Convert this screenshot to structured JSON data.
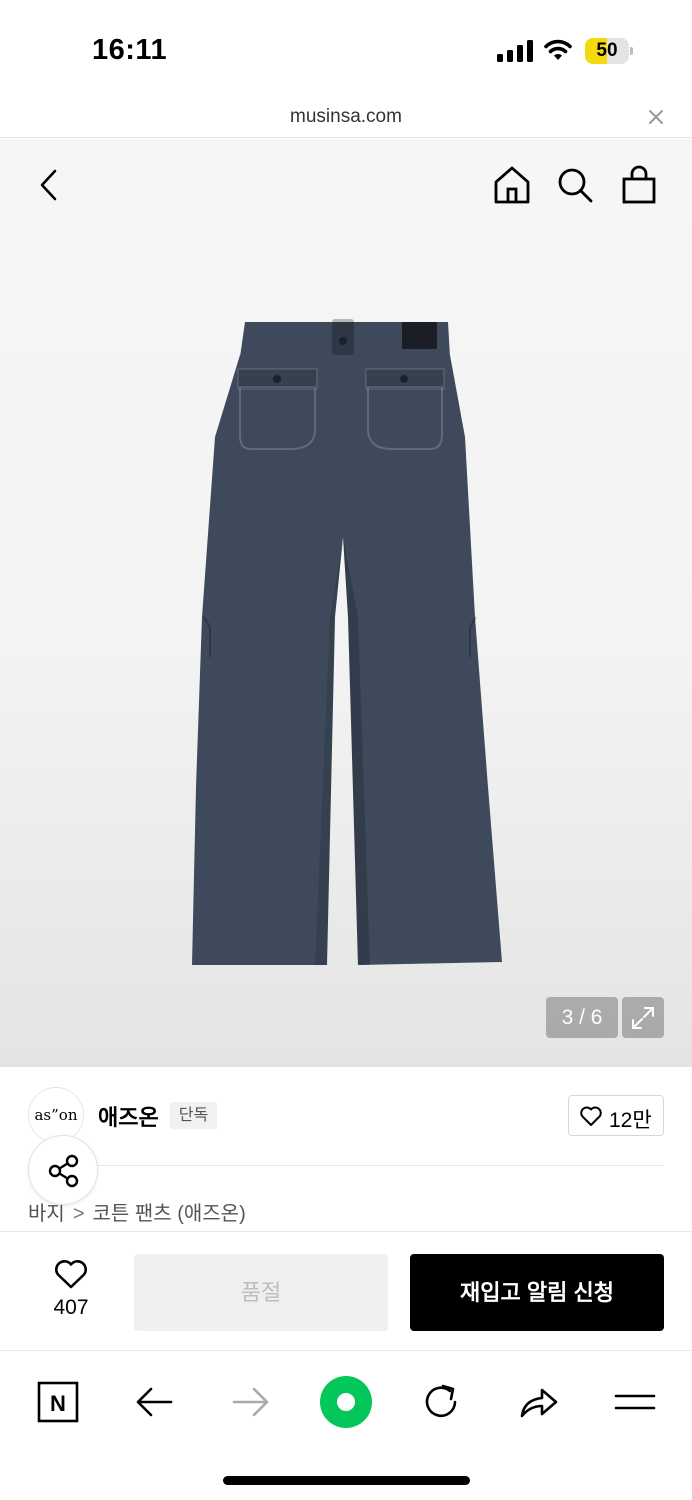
{
  "status_bar": {
    "time": "16:11",
    "battery_level": "50",
    "battery_fraction": 0.5,
    "battery_color": "#f5d90f"
  },
  "url_bar": {
    "url": "musinsa.com"
  },
  "product_image": {
    "counter": "3 / 6",
    "current_index": 3,
    "total": 6,
    "pants_color": "#3e4a5b"
  },
  "brand": {
    "logo_text": "as”on",
    "name": "애즈온",
    "badge": "단독",
    "like_count": "12만"
  },
  "breadcrumb": {
    "category": "바지",
    "separator": ">",
    "subcategory": "코튼 팬츠 (애즈온)"
  },
  "action_bar": {
    "wish_count": "407",
    "soldout_label": "품절",
    "restock_label": "재입고 알림 신청"
  },
  "browser_toolbar": {
    "brand_letter": "N",
    "accent_color": "#03c75a"
  },
  "icons": [
    "back-chevron-icon",
    "home-icon",
    "search-icon",
    "shopping-bag-icon",
    "expand-icon",
    "heart-icon",
    "share-icon",
    "arrow-left-icon",
    "arrow-right-icon",
    "reload-icon",
    "forward-share-icon",
    "menu-icon",
    "close-icon"
  ]
}
